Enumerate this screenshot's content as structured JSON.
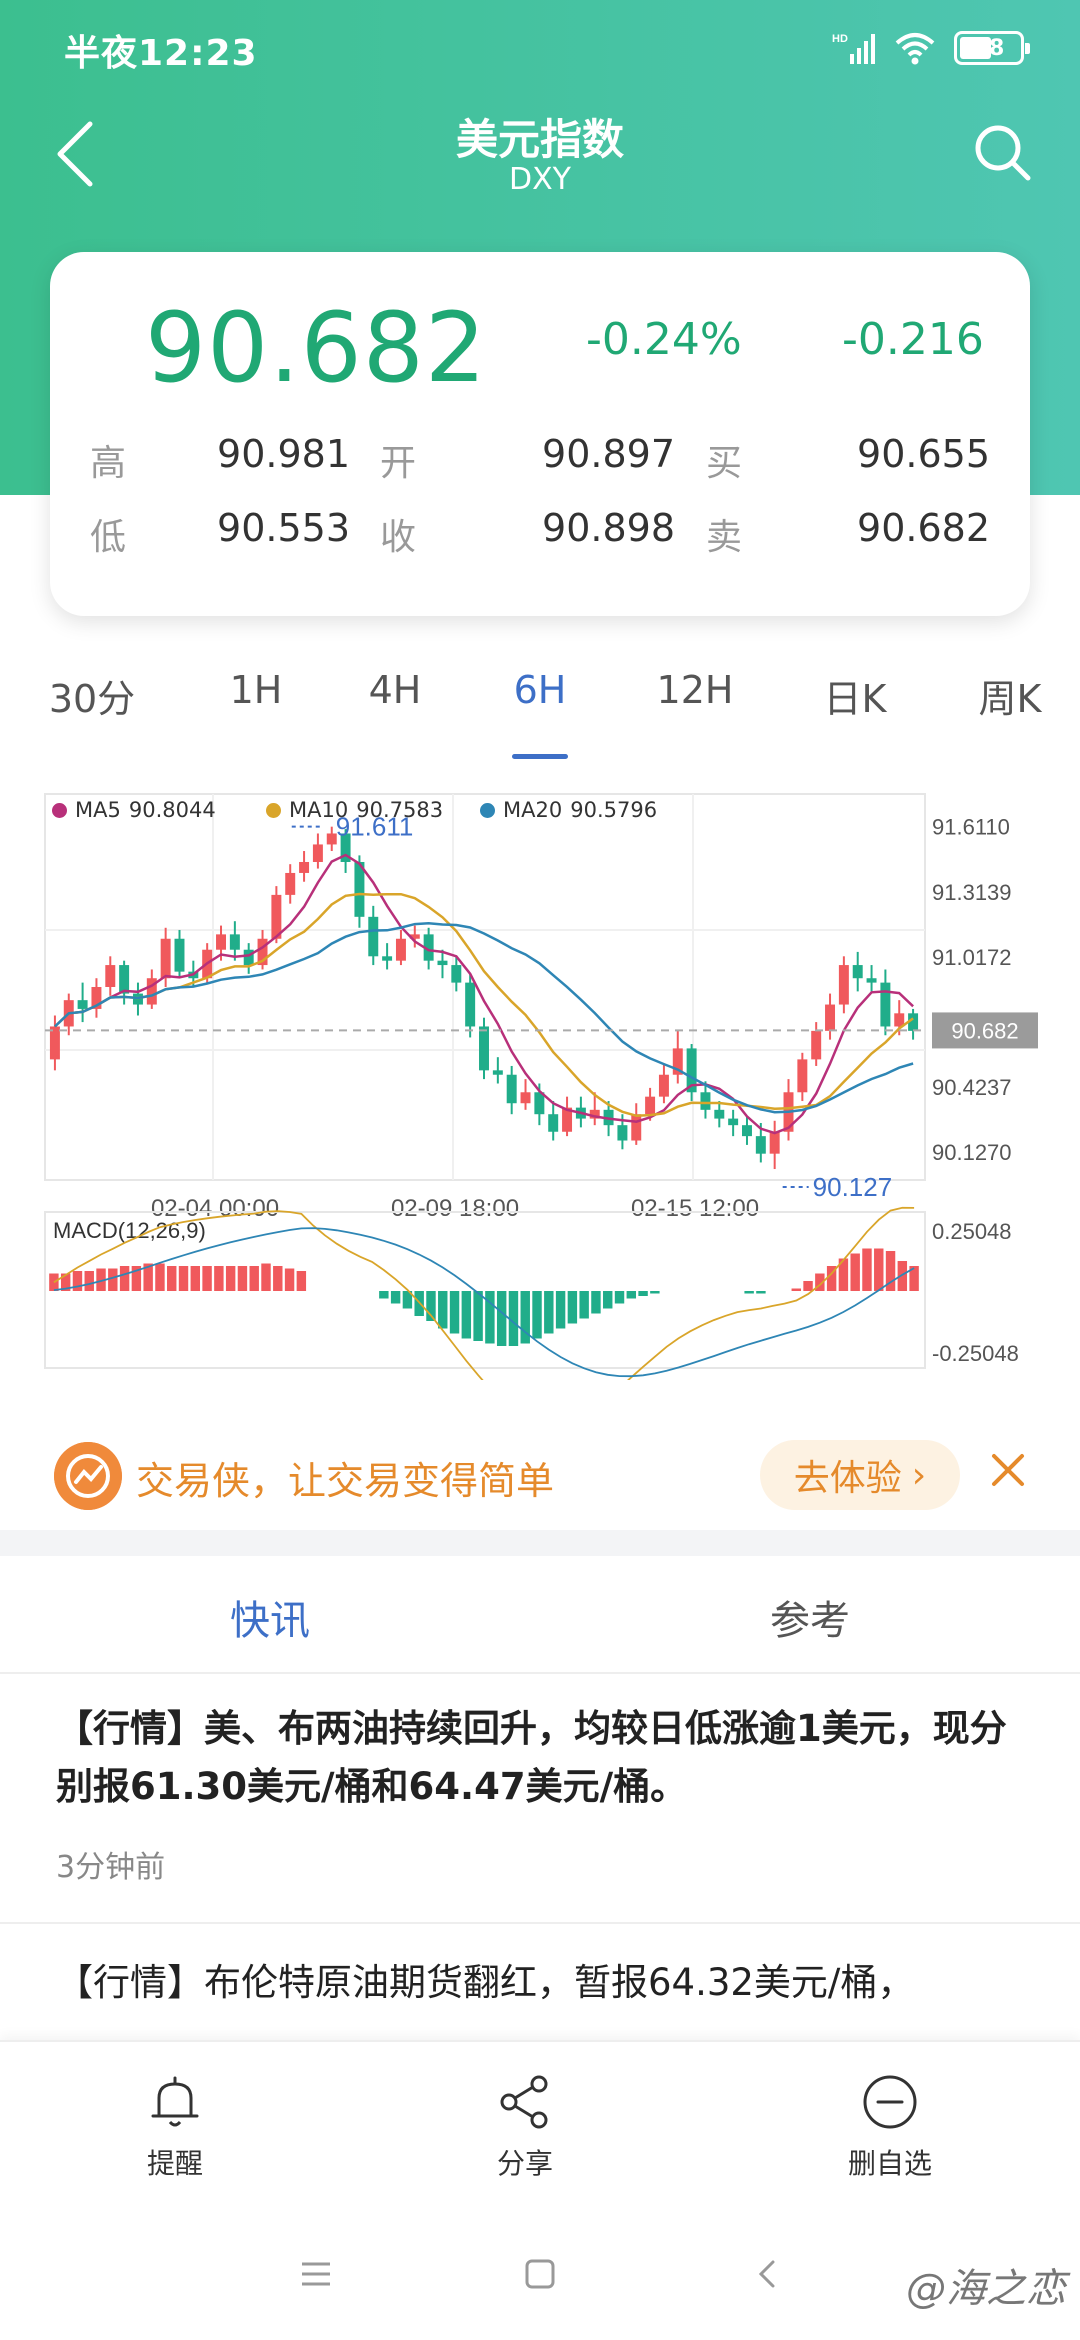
{
  "status": {
    "time": "半夜12:23",
    "network": "HD",
    "battery": "48"
  },
  "nav": {
    "title": "美元指数",
    "subtitle": "DXY",
    "back_icon": "back-arrow-icon",
    "search_icon": "search-icon"
  },
  "quote": {
    "price": "90.682",
    "pct_change": "-0.24%",
    "abs_change": "-0.216",
    "high_label": "高",
    "high": "90.981",
    "open_label": "开",
    "open": "90.897",
    "bid_label": "买",
    "bid": "90.655",
    "low_label": "低",
    "low": "90.553",
    "close_label": "收",
    "close": "90.898",
    "ask_label": "卖",
    "ask": "90.682",
    "accent": "#20a874"
  },
  "period_tabs": [
    "30分",
    "1H",
    "4H",
    "6H",
    "12H",
    "日K",
    "周K"
  ],
  "active_period": "6H",
  "chart_data": {
    "type": "candlestick",
    "legend": [
      {
        "name": "MA5",
        "value": "90.8044",
        "color": "#b8307a"
      },
      {
        "name": "MA10",
        "value": "90.7583",
        "color": "#d9a52a"
      },
      {
        "name": "MA20",
        "value": "90.5796",
        "color": "#2e86b5"
      }
    ],
    "y_ticks": [
      "91.6110",
      "91.3139",
      "91.0172",
      "90.4237",
      "90.1270"
    ],
    "ylim": [
      90.0,
      91.76
    ],
    "x_ticks": [
      "02-04 00:00",
      "02-09 18:00",
      "02-15 12:00"
    ],
    "max_label": "91.611",
    "min_label": "90.127",
    "last_price": "90.682",
    "up_color": "#f0595c",
    "down_color": "#20ad8a",
    "candles": [
      [
        90.55,
        90.7,
        90.5,
        90.75
      ],
      [
        90.7,
        90.82,
        90.66,
        90.85
      ],
      [
        90.82,
        90.78,
        90.72,
        90.9
      ],
      [
        90.78,
        90.88,
        90.74,
        90.92
      ],
      [
        90.88,
        90.98,
        90.84,
        91.02
      ],
      [
        90.98,
        90.85,
        90.8,
        91.0
      ],
      [
        90.85,
        90.8,
        90.75,
        90.9
      ],
      [
        90.8,
        90.92,
        90.78,
        90.96
      ],
      [
        90.92,
        91.1,
        90.88,
        91.15
      ],
      [
        91.1,
        90.95,
        90.92,
        91.14
      ],
      [
        90.95,
        90.92,
        90.88,
        91.0
      ],
      [
        90.92,
        91.05,
        90.9,
        91.08
      ],
      [
        91.05,
        91.12,
        91.0,
        91.16
      ],
      [
        91.12,
        91.05,
        91.0,
        91.18
      ],
      [
        91.05,
        90.98,
        90.94,
        91.08
      ],
      [
        90.98,
        91.1,
        90.96,
        91.14
      ],
      [
        91.1,
        91.3,
        91.08,
        91.34
      ],
      [
        91.3,
        91.4,
        91.26,
        91.44
      ],
      [
        91.4,
        91.45,
        91.36,
        91.5
      ],
      [
        91.45,
        91.53,
        91.42,
        91.58
      ],
      [
        91.53,
        91.58,
        91.5,
        91.611
      ],
      [
        91.58,
        91.45,
        91.4,
        91.6
      ],
      [
        91.45,
        91.2,
        91.15,
        91.48
      ],
      [
        91.2,
        91.02,
        90.98,
        91.25
      ],
      [
        91.02,
        91.0,
        90.96,
        91.08
      ],
      [
        91.0,
        91.1,
        90.98,
        91.14
      ],
      [
        91.1,
        91.12,
        91.06,
        91.16
      ],
      [
        91.12,
        91.0,
        90.96,
        91.15
      ],
      [
        91.0,
        90.98,
        90.92,
        91.05
      ],
      [
        90.98,
        90.9,
        90.86,
        91.02
      ],
      [
        90.9,
        90.7,
        90.65,
        90.94
      ],
      [
        90.7,
        90.5,
        90.46,
        90.74
      ],
      [
        90.5,
        90.48,
        90.44,
        90.56
      ],
      [
        90.48,
        90.35,
        90.3,
        90.52
      ],
      [
        90.35,
        90.4,
        90.32,
        90.46
      ],
      [
        90.4,
        90.3,
        90.25,
        90.44
      ],
      [
        90.3,
        90.22,
        90.18,
        90.36
      ],
      [
        90.22,
        90.33,
        90.2,
        90.38
      ],
      [
        90.33,
        90.28,
        90.24,
        90.38
      ],
      [
        90.28,
        90.32,
        90.25,
        90.4
      ],
      [
        90.32,
        90.25,
        90.2,
        90.36
      ],
      [
        90.25,
        90.18,
        90.14,
        90.3
      ],
      [
        90.18,
        90.3,
        90.16,
        90.35
      ],
      [
        90.3,
        90.38,
        90.27,
        90.42
      ],
      [
        90.38,
        90.48,
        90.35,
        90.53
      ],
      [
        90.48,
        90.6,
        90.44,
        90.68
      ],
      [
        90.6,
        90.4,
        90.36,
        90.62
      ],
      [
        90.4,
        90.32,
        90.28,
        90.45
      ],
      [
        90.32,
        90.28,
        90.24,
        90.36
      ],
      [
        90.28,
        90.25,
        90.2,
        90.32
      ],
      [
        90.25,
        90.2,
        90.16,
        90.29
      ],
      [
        90.2,
        90.12,
        90.08,
        90.26
      ],
      [
        90.12,
        90.22,
        90.05,
        90.27
      ],
      [
        90.22,
        90.4,
        90.18,
        90.46
      ],
      [
        90.4,
        90.55,
        90.36,
        90.58
      ],
      [
        90.55,
        90.68,
        90.52,
        90.72
      ],
      [
        90.68,
        90.8,
        90.64,
        90.85
      ],
      [
        90.8,
        90.98,
        90.76,
        91.02
      ],
      [
        90.98,
        90.92,
        90.86,
        91.04
      ],
      [
        90.92,
        90.9,
        90.86,
        90.98
      ],
      [
        90.9,
        90.7,
        90.66,
        90.96
      ],
      [
        90.7,
        90.76,
        90.66,
        90.82
      ],
      [
        90.76,
        90.68,
        90.64,
        90.78
      ]
    ],
    "macd": {
      "label": "MACD(12,26,9)",
      "y_ticks": [
        "0.25048",
        "-0.25048"
      ],
      "ylim": [
        -0.3,
        0.3
      ],
      "hist": [
        0.07,
        0.07,
        0.08,
        0.08,
        0.09,
        0.09,
        0.1,
        0.1,
        0.11,
        0.11,
        0.1,
        0.1,
        0.1,
        0.1,
        0.1,
        0.1,
        0.1,
        0.1,
        0.11,
        0.1,
        0.09,
        0.08,
        0,
        0,
        0,
        0,
        0,
        0,
        -0.03,
        -0.05,
        -0.07,
        -0.1,
        -0.12,
        -0.15,
        -0.17,
        -0.19,
        -0.2,
        -0.21,
        -0.22,
        -0.22,
        -0.21,
        -0.19,
        -0.17,
        -0.15,
        -0.13,
        -0.11,
        -0.09,
        -0.07,
        -0.05,
        -0.03,
        -0.02,
        -0.01,
        0,
        0,
        0,
        0,
        0,
        0,
        0,
        -0.01,
        -0.01,
        0,
        0,
        0.01,
        0.04,
        0.07,
        0.1,
        0.13,
        0.15,
        0.17,
        0.17,
        0.16,
        0.12,
        0.1
      ]
    }
  },
  "promo": {
    "text": "交易侠，让交易变得简单",
    "button": "去体验",
    "button_arrow": "›"
  },
  "news_tabs": [
    "快讯",
    "参考"
  ],
  "news": [
    {
      "title": "【行情】美、布两油持续回升，均较日低涨逾1美元，现分别报61.30美元/桶和64.47美元/桶。",
      "time": "3分钟前"
    },
    {
      "title": "【行情】布伦特原油期货翻红，暂报64.32美元/桶，"
    }
  ],
  "toolbar": {
    "alert": "提醒",
    "share": "分享",
    "remove": "删自选"
  },
  "watermark": "@海之恋"
}
